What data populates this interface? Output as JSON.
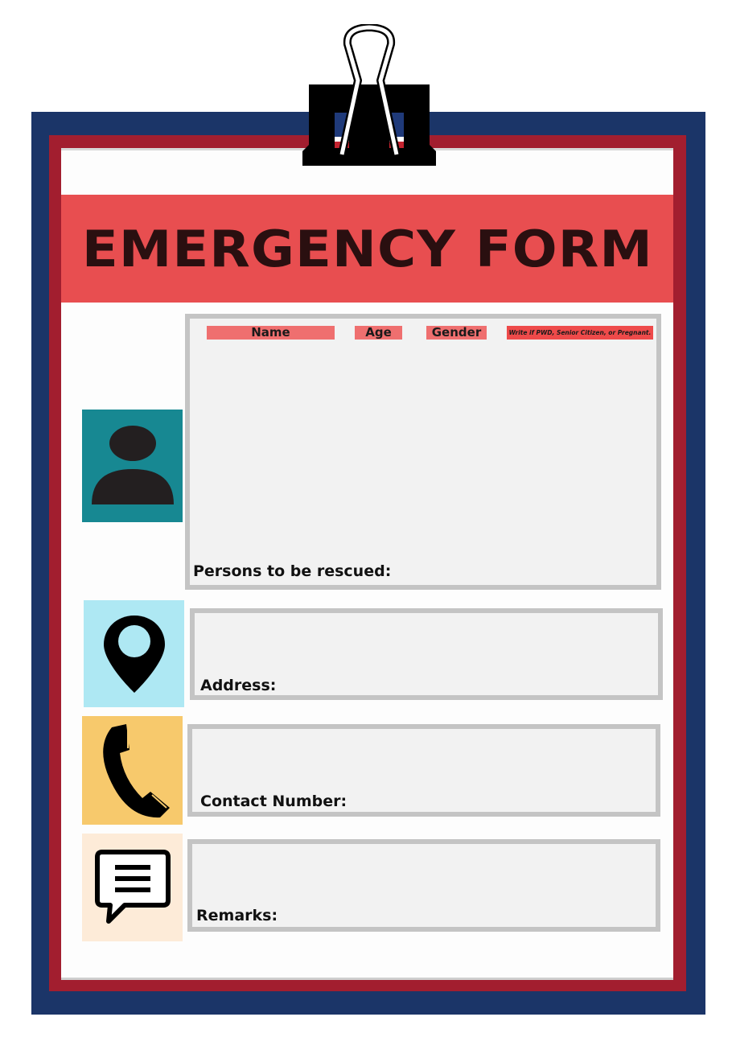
{
  "form": {
    "title": "EMERGENCY FORM"
  },
  "persons_section": {
    "label": "Persons to be rescued:",
    "columns": [
      {
        "label": "Name"
      },
      {
        "label": "Age"
      },
      {
        "label": "Gender"
      },
      {
        "label": "Write if PWD, Senior Citizen, or Pregnant."
      }
    ],
    "icon": "person-icon"
  },
  "address_section": {
    "label": "Address:",
    "icon": "location-pin-icon"
  },
  "contact_section": {
    "label": "Contact Number:",
    "icon": "phone-icon"
  },
  "remarks_section": {
    "label": "Remarks:",
    "icon": "chat-bubble-icon"
  },
  "colors": {
    "board_navy": "#1b3568",
    "board_red": "#a21e2f",
    "banner_red": "#e84e50",
    "person_tile": "#178892",
    "pin_tile": "#aee8f3",
    "phone_tile": "#f7c96c",
    "chat_tile": "#fdebd8"
  }
}
